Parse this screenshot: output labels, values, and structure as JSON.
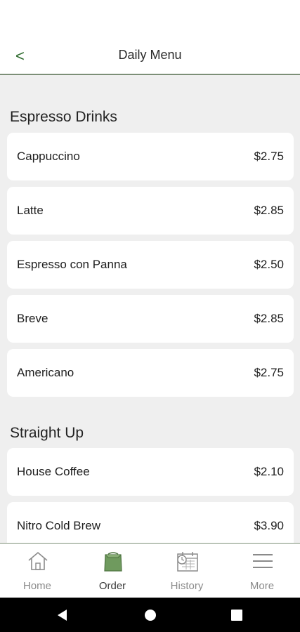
{
  "header": {
    "title": "Daily Menu",
    "back_glyph": "<"
  },
  "sections": [
    {
      "title": "Espresso Drinks",
      "items": [
        {
          "name": "Cappuccino",
          "price": "$2.75"
        },
        {
          "name": "Latte",
          "price": "$2.85"
        },
        {
          "name": "Espresso con Panna",
          "price": "$2.50"
        },
        {
          "name": "Breve",
          "price": "$2.85"
        },
        {
          "name": "Americano",
          "price": "$2.75"
        }
      ]
    },
    {
      "title": "Straight Up",
      "items": [
        {
          "name": "House Coffee",
          "price": "$2.10"
        },
        {
          "name": "Nitro Cold Brew",
          "price": "$3.90"
        }
      ]
    }
  ],
  "bottom_nav": {
    "items": [
      {
        "label": "Home",
        "icon": "home-icon",
        "active": false
      },
      {
        "label": "Order",
        "icon": "order-bag-icon",
        "active": true
      },
      {
        "label": "History",
        "icon": "history-icon",
        "active": false
      },
      {
        "label": "More",
        "icon": "menu-icon",
        "active": false
      }
    ]
  },
  "system_nav": {
    "buttons": [
      "back-triangle-icon",
      "home-circle-icon",
      "recents-square-icon"
    ]
  },
  "colors": {
    "accent": "#2e6b2e",
    "divider": "#7c8f77",
    "background": "#efefef",
    "card": "#ffffff",
    "active_icon": "#6f9a5e"
  }
}
